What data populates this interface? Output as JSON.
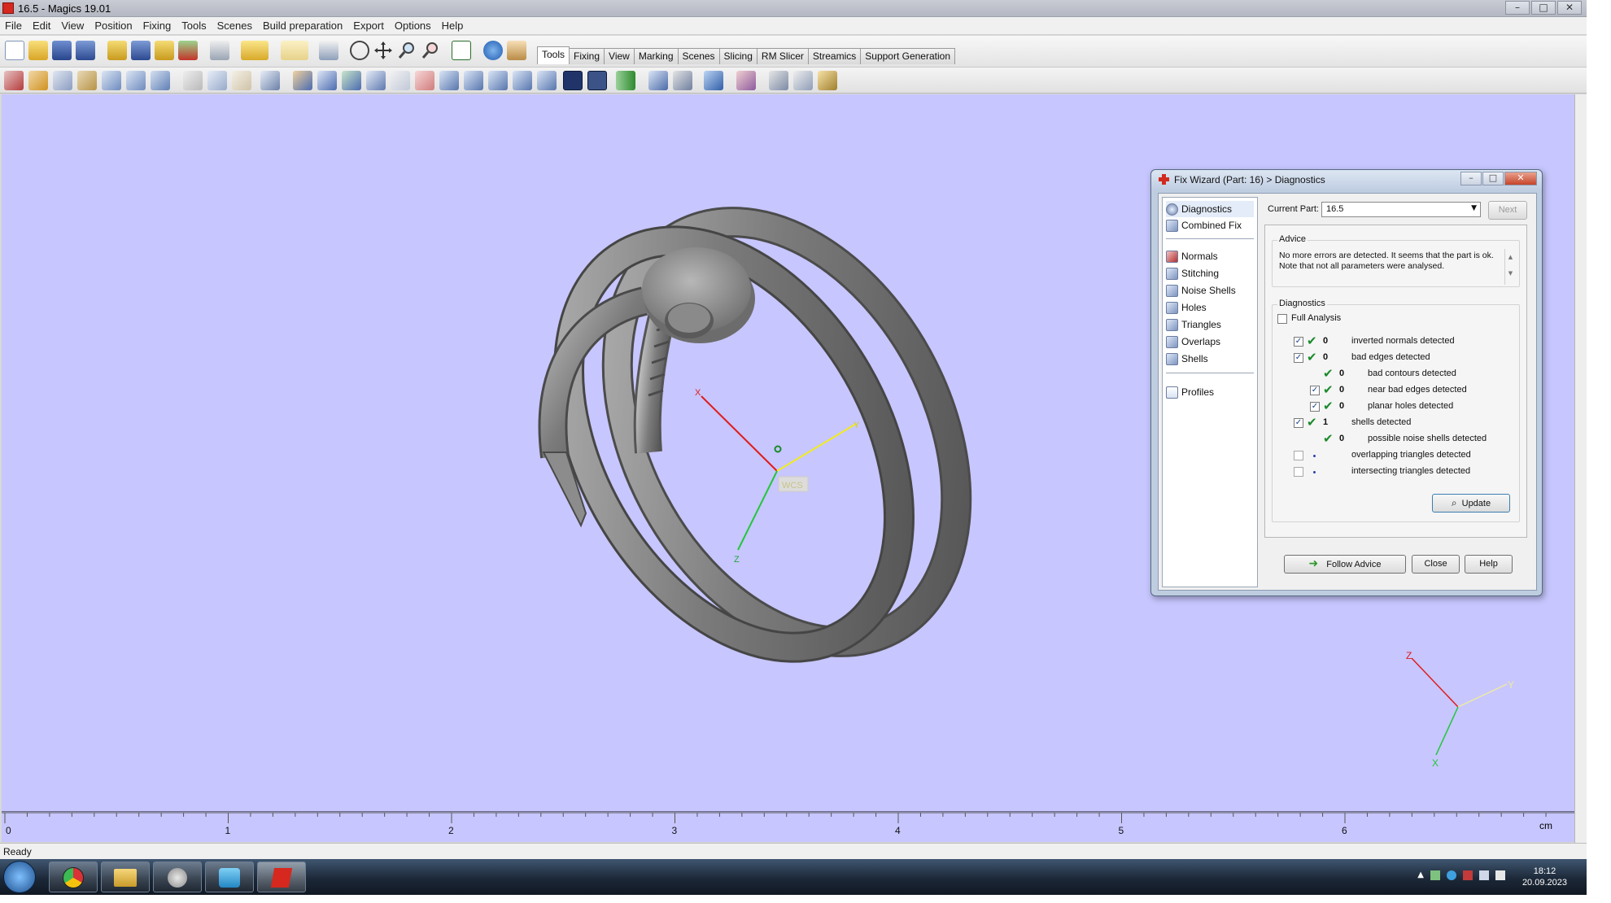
{
  "window": {
    "title": "16.5 - Magics 19.01",
    "minimize": "–",
    "maximize": "□",
    "close": "✕"
  },
  "menu": [
    "File",
    "Edit",
    "View",
    "Position",
    "Fixing",
    "Tools",
    "Scenes",
    "Build preparation",
    "Export",
    "Options",
    "Help"
  ],
  "toolbar_tabs": [
    "Tools",
    "Fixing",
    "View",
    "Marking",
    "Scenes",
    "Slicing",
    "RM Slicer",
    "Streamics",
    "Support Generation"
  ],
  "active_tab": "Tools",
  "viewport": {
    "wcs_label": "WCS",
    "axes": {
      "x": "X",
      "y": "Y",
      "z": "Z"
    },
    "orient_axes": {
      "x": "X",
      "y": "Y",
      "z": "Z"
    },
    "ruler": {
      "ticks": [
        "0",
        "1",
        "2",
        "3",
        "4",
        "5",
        "6"
      ],
      "unit": "cm"
    }
  },
  "status": {
    "text": "Ready"
  },
  "taskbar": {
    "time": "18:12",
    "date": "20.09.2023"
  },
  "dialog": {
    "title": "Fix Wizard (Part: 16) > Diagnostics",
    "nav_top": [
      "Diagnostics",
      "Combined Fix"
    ],
    "nav_tools": [
      "Normals",
      "Stitching",
      "Noise Shells",
      "Holes",
      "Triangles",
      "Overlaps",
      "Shells"
    ],
    "nav_bottom": [
      "Profiles"
    ],
    "current_part_label": "Current Part:",
    "current_part_value": "16.5",
    "next_label": "Next",
    "advice_legend": "Advice",
    "advice_text": "No more errors are detected. It seems that the part is ok. Note that not all parameters were analysed.",
    "diagnostics_legend": "Diagnostics",
    "full_analysis_label": "Full Analysis",
    "rows": [
      {
        "checked": true,
        "status": "ok",
        "count": "0",
        "label": "inverted normals detected"
      },
      {
        "checked": true,
        "status": "ok",
        "count": "0",
        "label": "bad edges detected"
      },
      {
        "checked": null,
        "status": "ok",
        "count": "0",
        "label": "bad contours detected"
      },
      {
        "checked": true,
        "status": "ok",
        "count": "0",
        "label": "near bad edges detected"
      },
      {
        "checked": true,
        "status": "ok",
        "count": "0",
        "label": "planar holes detected"
      },
      {
        "checked": true,
        "status": "ok",
        "count": "1",
        "label": "shells detected"
      },
      {
        "checked": null,
        "status": "ok",
        "count": "0",
        "label": "possible noise shells detected"
      },
      {
        "checked": false,
        "status": "none",
        "count": "",
        "label": "overlapping triangles detected"
      },
      {
        "checked": false,
        "status": "none",
        "count": "",
        "label": "intersecting triangles detected"
      }
    ],
    "update_label": "Update",
    "follow_advice_label": "Follow Advice",
    "close_label": "Close",
    "help_label": "Help"
  }
}
